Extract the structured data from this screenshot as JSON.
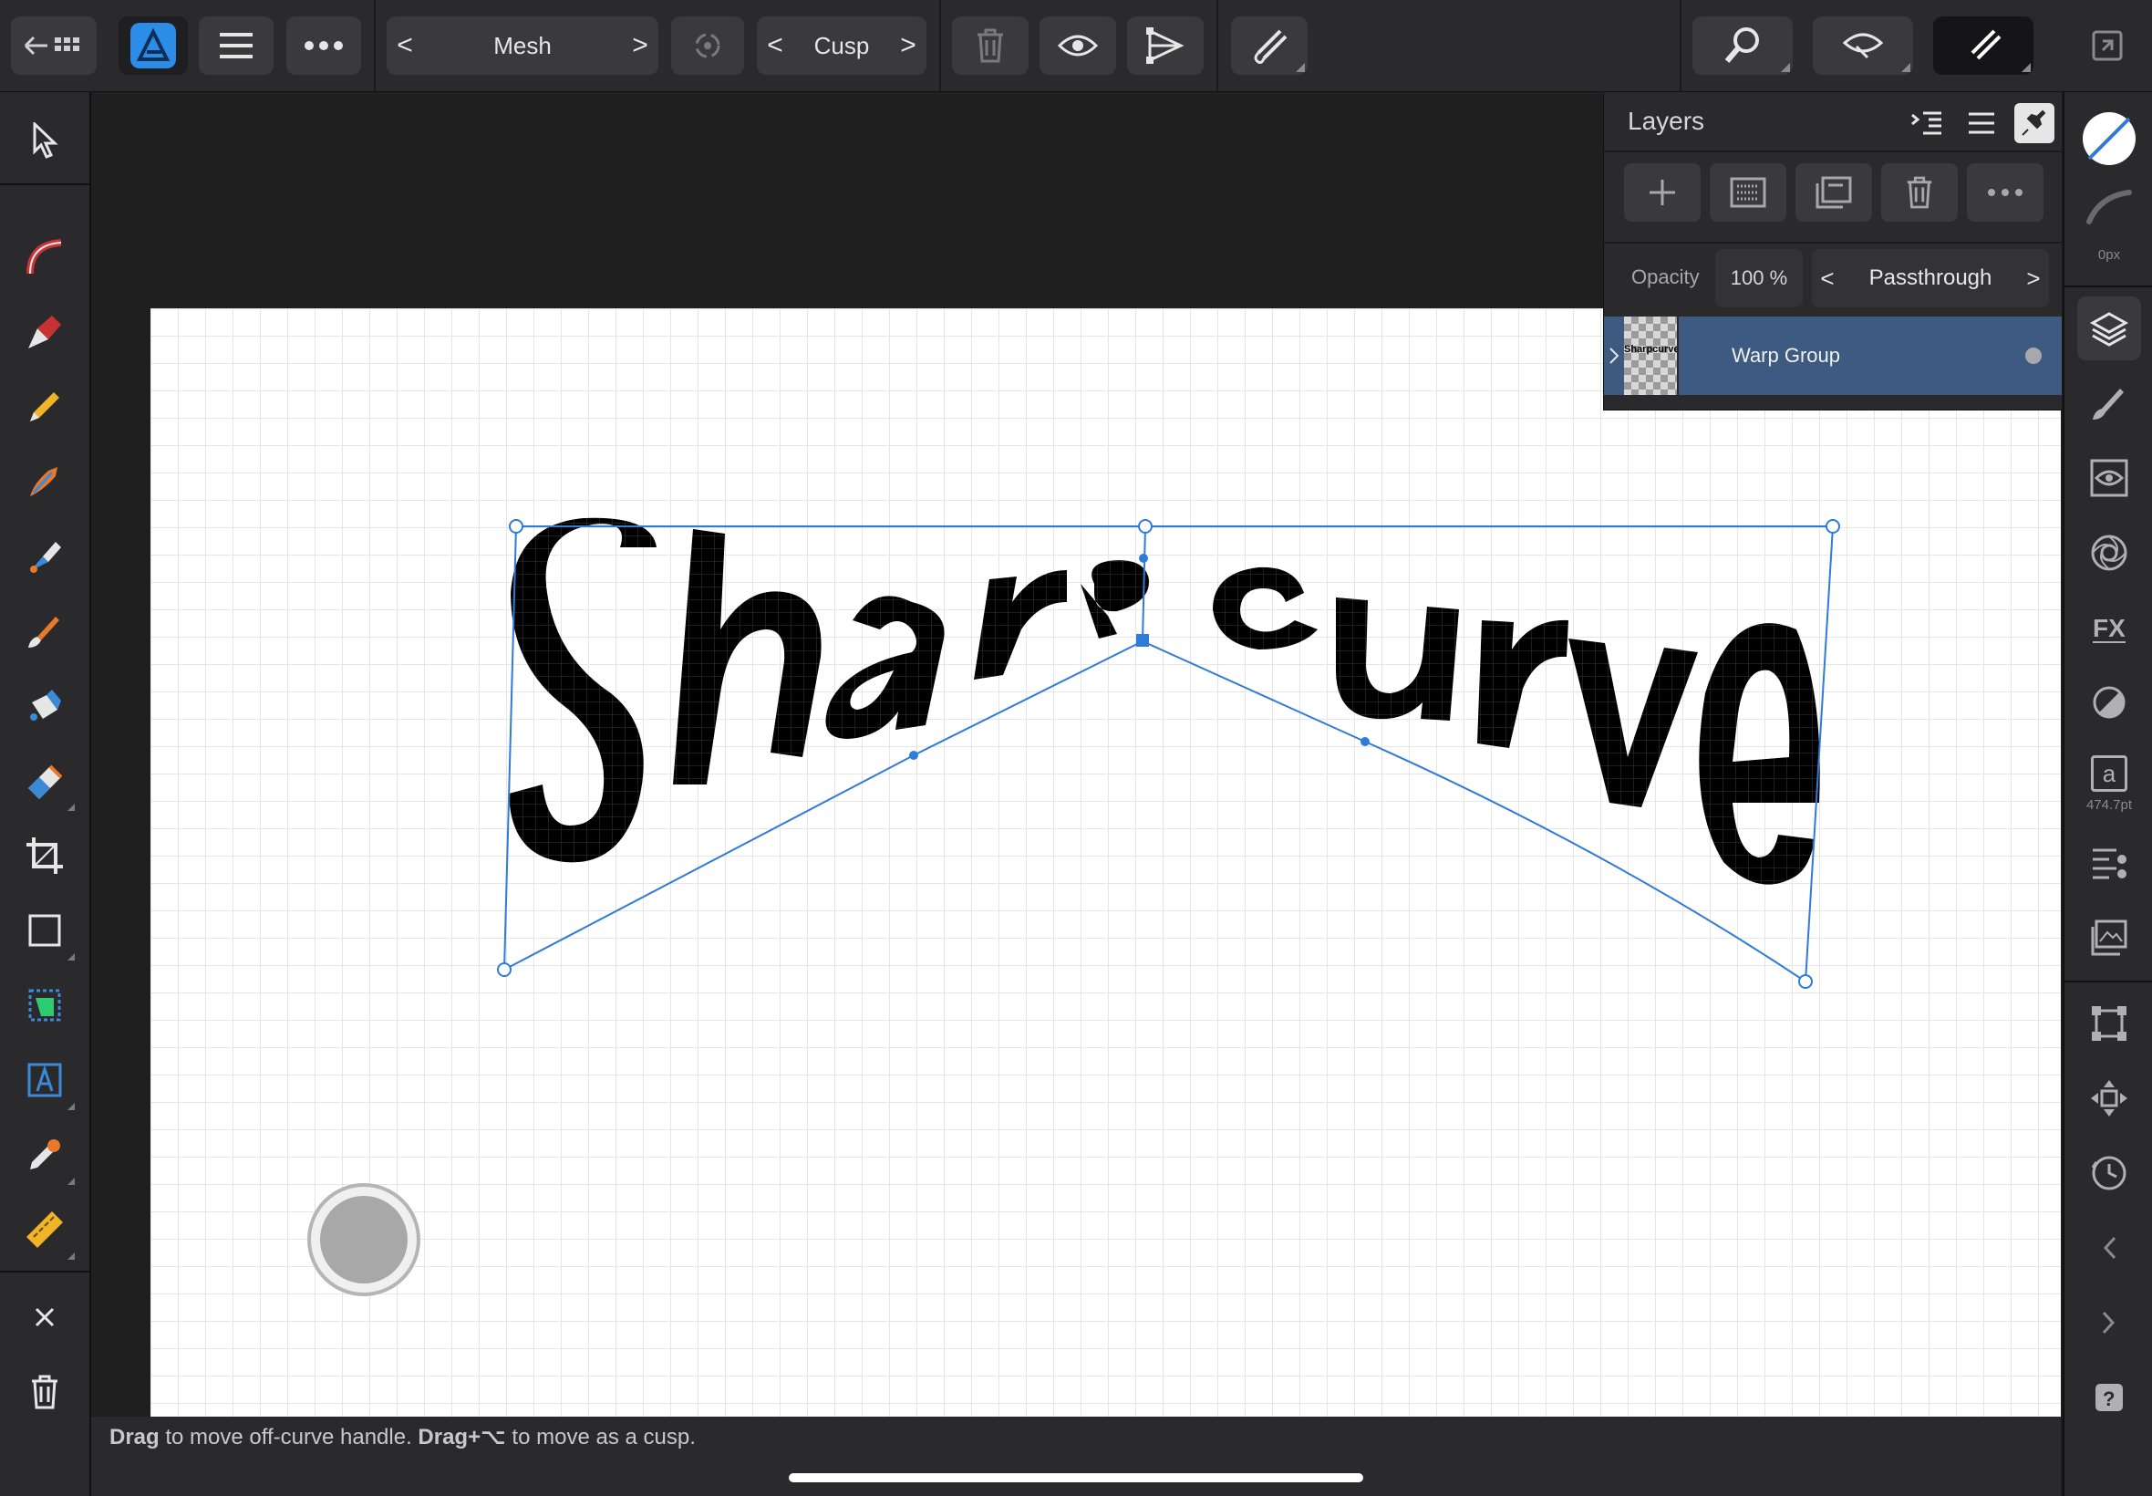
{
  "toolbar": {
    "mode_label": "Mesh",
    "node_type_label": "Cusp",
    "prev_arrow": "<",
    "next_arrow": ">"
  },
  "layers_panel": {
    "title": "Layers",
    "opacity_label": "Opacity",
    "opacity_value": "100 %",
    "blend_mode": "Passthrough",
    "layer": {
      "name": "Warp Group",
      "thumbnail_text": "Sharpcurve"
    }
  },
  "canvas": {
    "artwork_text": "Sharpcurve"
  },
  "right_studio": {
    "stroke_width": "0px",
    "font_size": "474.7pt",
    "text_icon_glyph": "a"
  },
  "status": {
    "hint_bold_1": "Drag",
    "hint_text_1": " to move off-curve handle. ",
    "hint_bold_2": "Drag+⌥",
    "hint_text_2": " to move as a cusp."
  },
  "colors": {
    "accent": "#2f7bd8",
    "selection": "#3d5a80",
    "panel": "#2a2a2c",
    "button": "#3a3a3d"
  }
}
